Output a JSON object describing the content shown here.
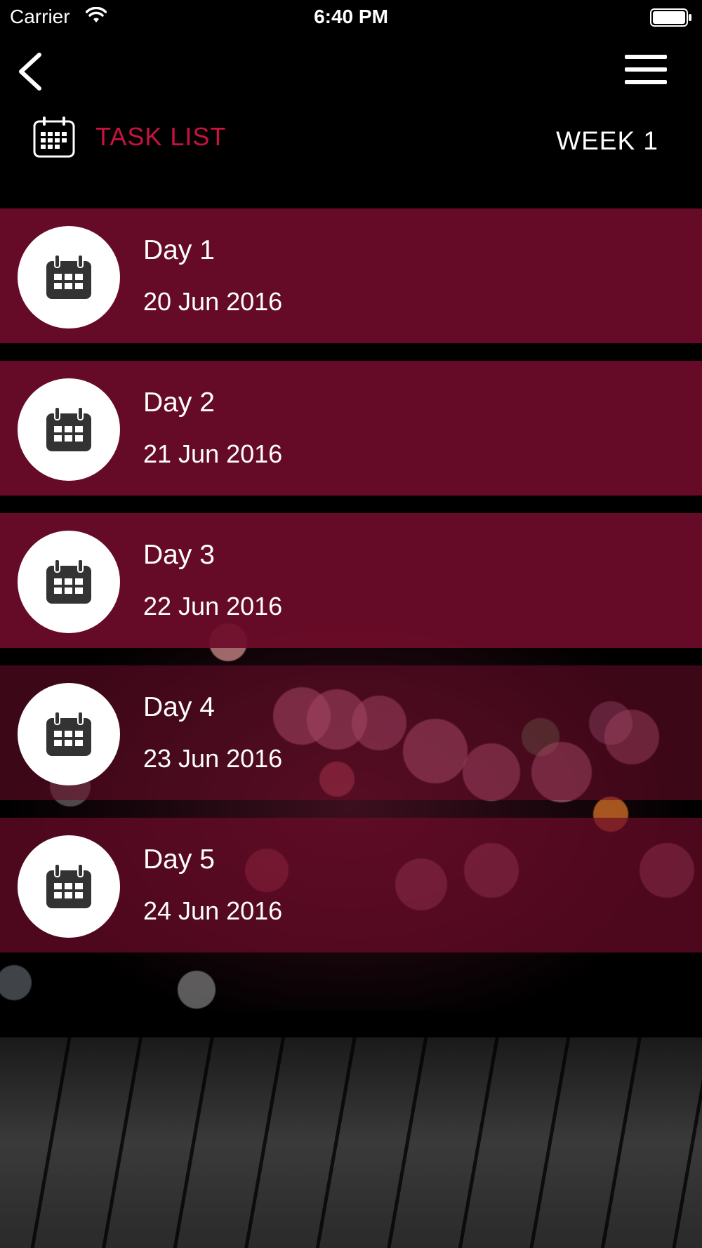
{
  "status_bar": {
    "carrier": "Carrier",
    "time": "6:40 PM",
    "wifi_icon": "wifi-icon",
    "battery_icon": "battery-icon"
  },
  "nav": {
    "back_icon": "chevron-left-icon",
    "menu_icon": "hamburger-menu-icon"
  },
  "header": {
    "icon": "calendar-icon",
    "title": "TASK LIST",
    "week": "WEEK 1"
  },
  "tasks": [
    {
      "day": "Day 1",
      "date": "20 Jun 2016",
      "icon": "calendar-icon"
    },
    {
      "day": "Day 2",
      "date": "21 Jun 2016",
      "icon": "calendar-icon"
    },
    {
      "day": "Day 3",
      "date": "22 Jun 2016",
      "icon": "calendar-icon"
    },
    {
      "day": "Day 4",
      "date": "23 Jun 2016",
      "icon": "calendar-icon"
    },
    {
      "day": "Day 5",
      "date": "24 Jun 2016",
      "icon": "calendar-icon"
    }
  ],
  "colors": {
    "accent": "#c8123f",
    "row_background": "#6e0c2a",
    "background": "#000000",
    "text": "#ffffff"
  }
}
